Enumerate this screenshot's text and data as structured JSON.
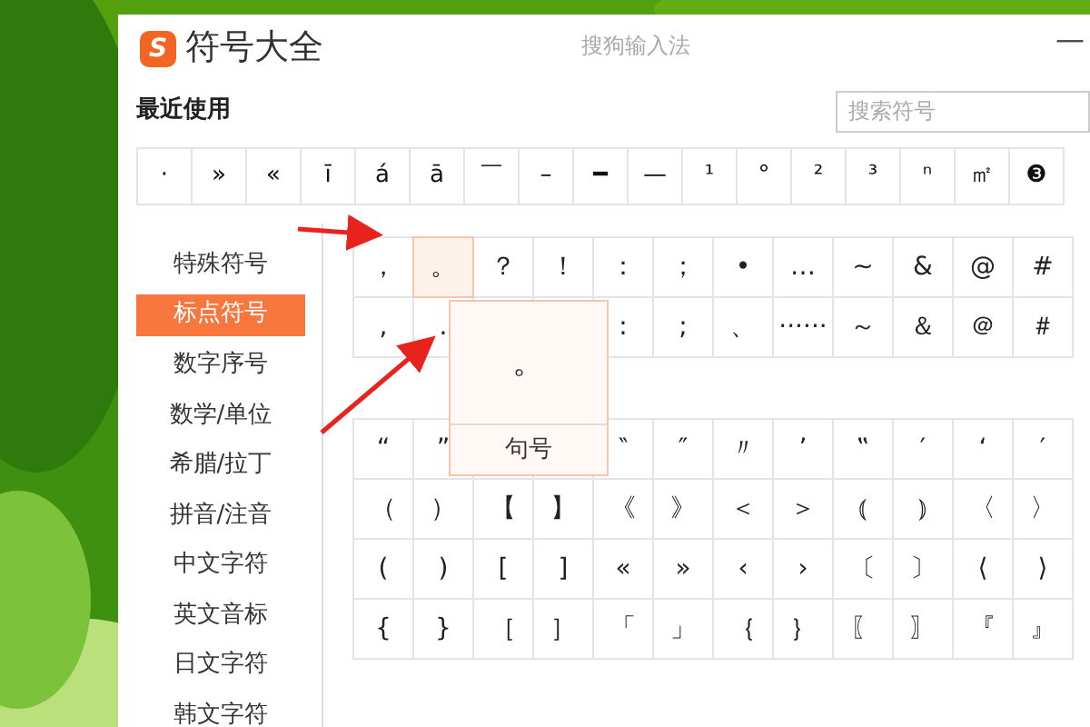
{
  "window": {
    "logo": "S",
    "title": "符号大全",
    "app_name": "搜狗输入法",
    "minimize": "—"
  },
  "recent": {
    "label": "最近使用",
    "symbols": [
      "·",
      "»",
      "«",
      "ī",
      "á",
      "ā",
      "￣",
      "–",
      "━",
      "—",
      "¹",
      "°",
      "²",
      "³",
      "ⁿ",
      "㎡",
      "❸"
    ]
  },
  "search": {
    "placeholder": "搜索符号"
  },
  "categories": [
    {
      "label": "特殊符号",
      "selected": false
    },
    {
      "label": "标点符号",
      "selected": true
    },
    {
      "label": "数字序号",
      "selected": false
    },
    {
      "label": "数学/单位",
      "selected": false
    },
    {
      "label": "希腊/拉丁",
      "selected": false
    },
    {
      "label": "拼音/注音",
      "selected": false
    },
    {
      "label": "中文字符",
      "selected": false
    },
    {
      "label": "英文音标",
      "selected": false
    },
    {
      "label": "日文字符",
      "selected": false
    },
    {
      "label": "韩文字符",
      "selected": false
    }
  ],
  "upper_rows": [
    {
      "cells": [
        {
          "symbol": "，",
          "selected": false
        },
        {
          "symbol": "。",
          "selected": true
        },
        {
          "symbol": "？",
          "selected": false
        },
        {
          "symbol": "！",
          "selected": false
        },
        {
          "symbol": "：",
          "selected": false
        },
        {
          "symbol": "；",
          "selected": false
        },
        {
          "symbol": "•",
          "selected": false
        },
        {
          "symbol": "…",
          "selected": false
        },
        {
          "symbol": "~",
          "selected": false
        },
        {
          "symbol": "&",
          "selected": false
        },
        {
          "symbol": "@",
          "selected": false
        },
        {
          "symbol": "#",
          "selected": false
        }
      ]
    },
    {
      "cells": [
        {
          "symbol": ",",
          "selected": false
        },
        {
          "symbol": ".",
          "selected": false
        }
      ],
      "cells_after_popup": [
        {
          "symbol": ":",
          "selected": false
        },
        {
          "symbol": ";",
          "selected": false
        },
        {
          "symbol": "、",
          "selected": false
        },
        {
          "symbol": "······",
          "selected": false
        },
        {
          "symbol": "～",
          "selected": false
        },
        {
          "symbol": "＆",
          "selected": false
        },
        {
          "symbol": "＠",
          "selected": false
        },
        {
          "symbol": "＃",
          "selected": false
        }
      ]
    }
  ],
  "lower_rows": [
    {
      "cells": [
        {
          "symbol": "“",
          "selected": false
        },
        {
          "symbol": "”",
          "selected": false
        }
      ],
      "cells_after_popup": [
        {
          "symbol": "‶",
          "selected": false
        },
        {
          "symbol": "″",
          "selected": false
        },
        {
          "symbol": "〃",
          "selected": false
        },
        {
          "symbol": "’",
          "selected": false
        },
        {
          "symbol": "‟",
          "selected": false
        },
        {
          "symbol": "′",
          "selected": false
        },
        {
          "symbol": "‘",
          "selected": false
        },
        {
          "symbol": "′",
          "selected": false
        }
      ]
    },
    {
      "cells": [
        {
          "symbol": "（",
          "selected": false
        },
        {
          "symbol": "）",
          "selected": false
        },
        {
          "symbol": "【",
          "selected": false
        },
        {
          "symbol": "】",
          "selected": false
        },
        {
          "symbol": "《",
          "selected": false
        },
        {
          "symbol": "》",
          "selected": false
        },
        {
          "symbol": "＜",
          "selected": false
        },
        {
          "symbol": "＞",
          "selected": false
        },
        {
          "symbol": "⦅",
          "selected": false
        },
        {
          "symbol": "⦆",
          "selected": false
        },
        {
          "symbol": "〈",
          "selected": false
        },
        {
          "symbol": "〉",
          "selected": false
        }
      ]
    },
    {
      "cells": [
        {
          "symbol": "(",
          "selected": false
        },
        {
          "symbol": ")",
          "selected": false
        },
        {
          "symbol": "[",
          "selected": false
        },
        {
          "symbol": "]",
          "selected": false
        },
        {
          "symbol": "«",
          "selected": false
        },
        {
          "symbol": "»",
          "selected": false
        },
        {
          "symbol": "‹",
          "selected": false
        },
        {
          "symbol": "›",
          "selected": false
        },
        {
          "symbol": "〔",
          "selected": false
        },
        {
          "symbol": "〕",
          "selected": false
        },
        {
          "symbol": "⟨",
          "selected": false
        },
        {
          "symbol": "⟩",
          "selected": false
        }
      ]
    },
    {
      "cells": [
        {
          "symbol": "{",
          "selected": false
        },
        {
          "symbol": "}",
          "selected": false
        },
        {
          "symbol": "［",
          "selected": false
        },
        {
          "symbol": "］",
          "selected": false
        },
        {
          "symbol": "「",
          "selected": false
        },
        {
          "symbol": "」",
          "selected": false
        },
        {
          "symbol": "｛",
          "selected": false
        },
        {
          "symbol": "｝",
          "selected": false
        },
        {
          "symbol": "〖",
          "selected": false
        },
        {
          "symbol": "〗",
          "selected": false
        },
        {
          "symbol": "『",
          "selected": false
        },
        {
          "symbol": "』",
          "selected": false
        }
      ]
    }
  ],
  "popup": {
    "symbol": "。",
    "name": "句号"
  }
}
